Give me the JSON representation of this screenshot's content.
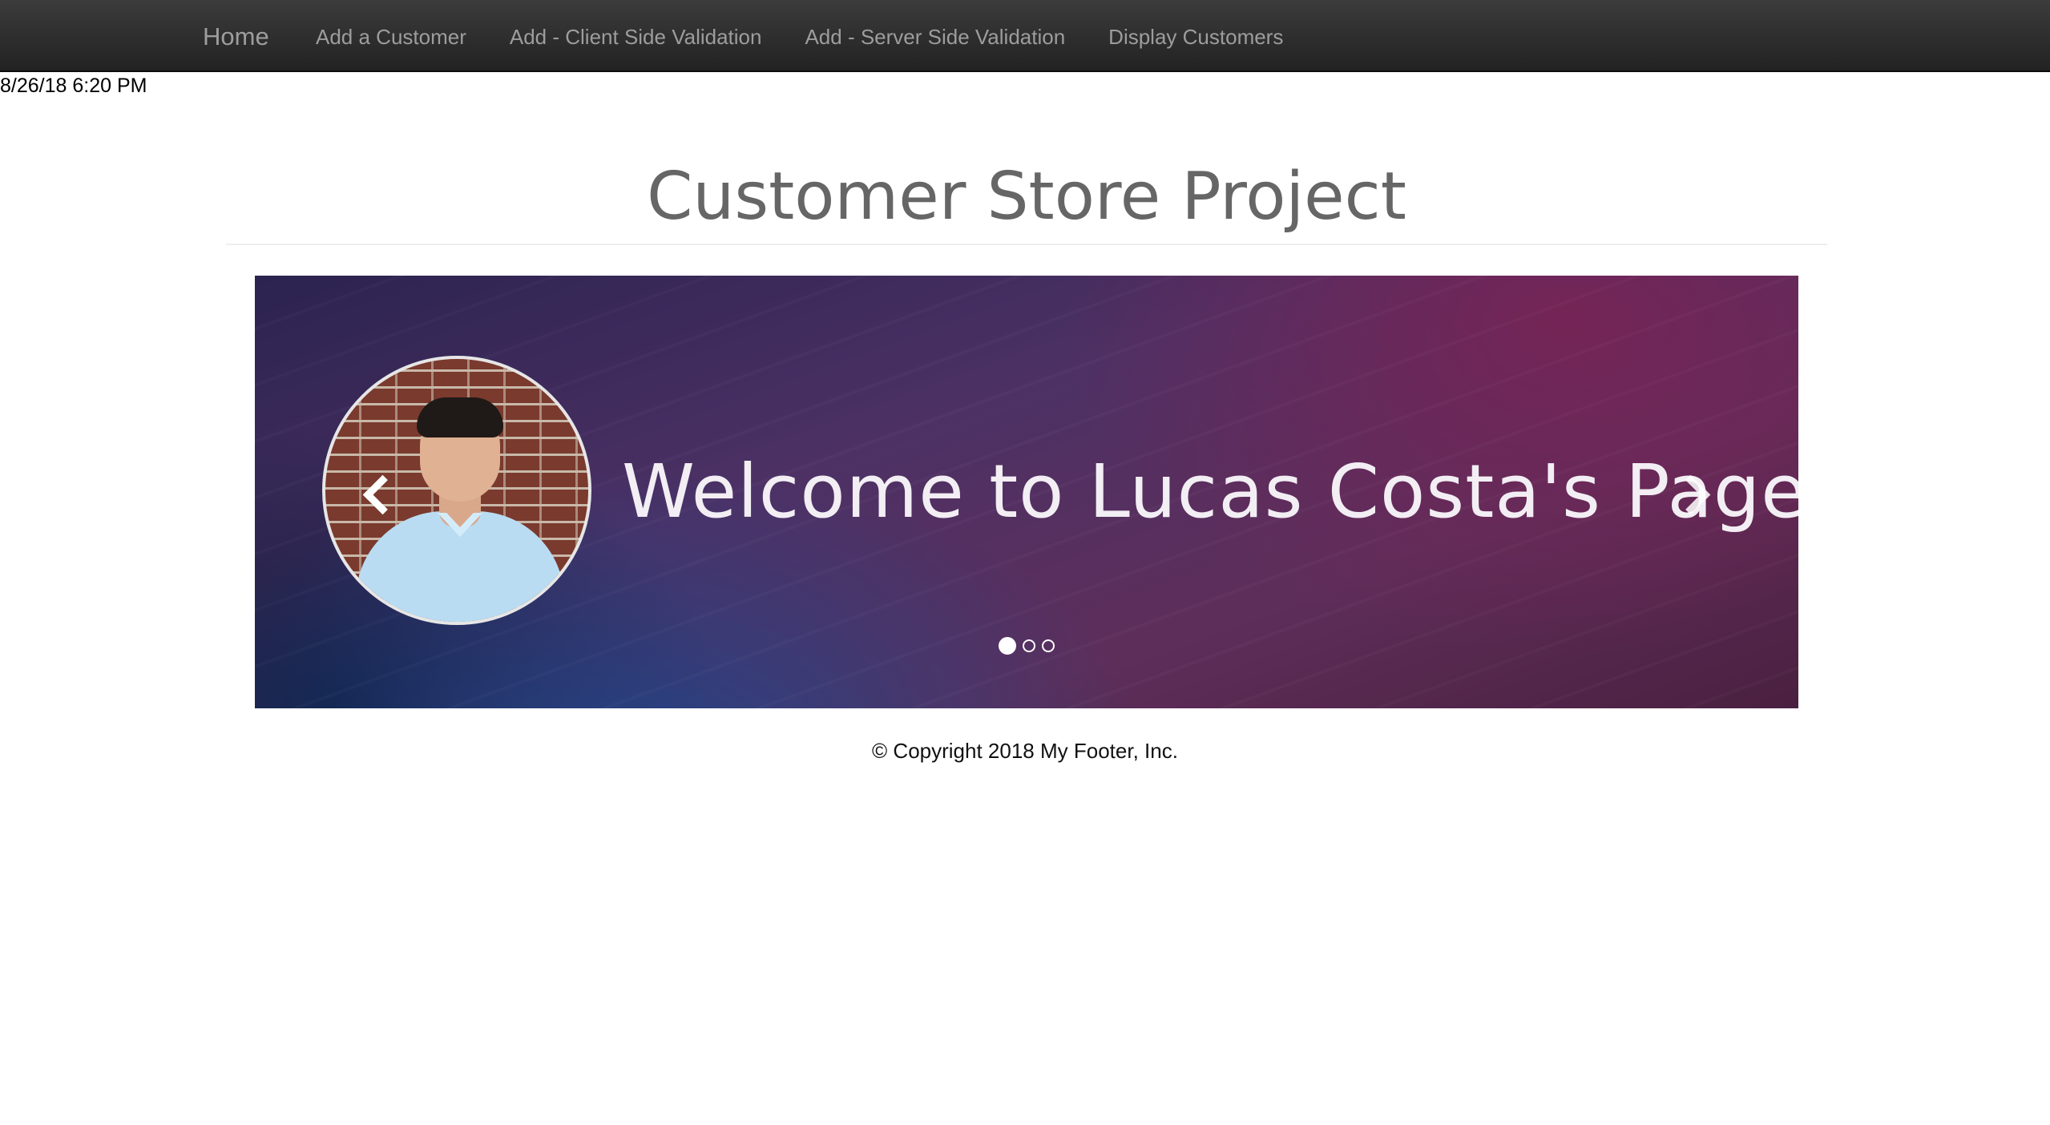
{
  "navbar": {
    "brand": "Home",
    "links": [
      {
        "label": "Add a Customer"
      },
      {
        "label": "Add - Client Side Validation"
      },
      {
        "label": "Add - Server Side Validation"
      },
      {
        "label": "Display Customers"
      }
    ]
  },
  "timestamp": "8/26/18 6:20 PM",
  "header": {
    "title": "Customer Store Project"
  },
  "carousel": {
    "slide_text": "Welcome to Lucas Costa's Page!",
    "prev_icon": "chevron-left-icon",
    "next_icon": "chevron-right-icon",
    "slide_count": 3,
    "active_slide": 1
  },
  "footer": {
    "text": "© Copyright 2018 My Footer, Inc."
  },
  "colors": {
    "navbar_bg": "#222222",
    "nav_text": "#9d9d9d",
    "title_text": "#666666"
  }
}
